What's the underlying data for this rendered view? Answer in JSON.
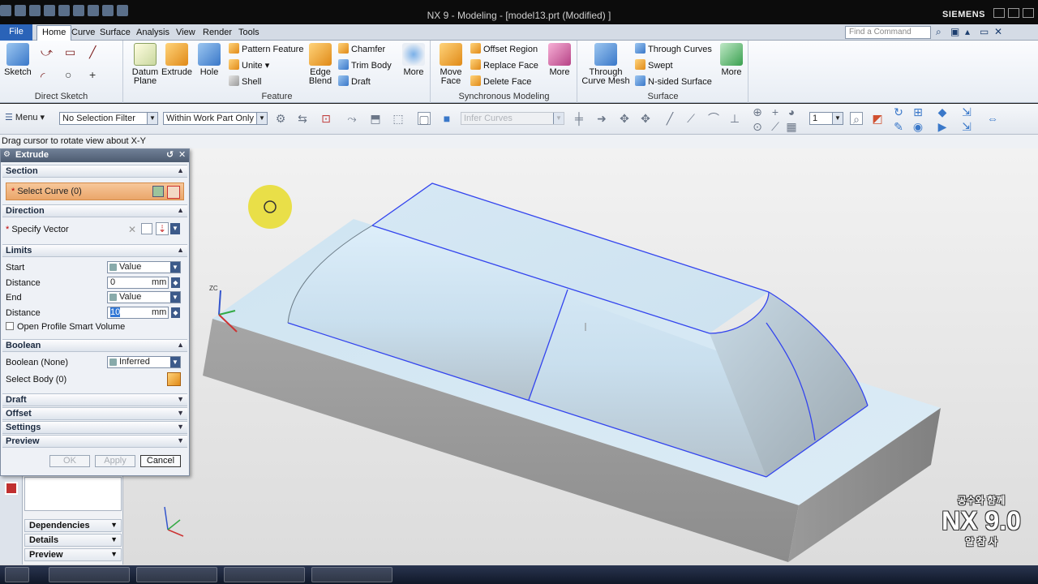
{
  "window": {
    "title": "NX 9 - Modeling - [model13.prt (Modified) ]",
    "brand": "SIEMENS",
    "qat_label": "Window"
  },
  "menu": {
    "items": [
      "File",
      "Home",
      "Curve",
      "Surface",
      "Analysis",
      "View",
      "Render",
      "Tools"
    ],
    "find_command_placeholder": "Find a Command"
  },
  "ribbon": {
    "direct_sketch": {
      "label": "Direct Sketch",
      "sketch": "Sketch"
    },
    "feature": {
      "label": "Feature",
      "datum_plane": "Datum Plane",
      "extrude": "Extrude",
      "hole": "Hole",
      "pattern_feature": "Pattern Feature",
      "unite": "Unite",
      "shell": "Shell",
      "edge_blend": "Edge Blend",
      "chamfer": "Chamfer",
      "trim_body": "Trim Body",
      "draft": "Draft",
      "more": "More"
    },
    "sync": {
      "label": "Synchronous Modeling",
      "move_face": "Move Face",
      "offset_region": "Offset Region",
      "replace_face": "Replace Face",
      "delete_face": "Delete Face",
      "more": "More"
    },
    "surface": {
      "label": "Surface",
      "through_curve_mesh": "Through Curve Mesh",
      "through_curves": "Through Curves",
      "swept": "Swept",
      "n_sided": "N-sided Surface",
      "more": "More"
    }
  },
  "selection_bar": {
    "menu": "Menu",
    "filter": "No Selection Filter",
    "scope": "Within Work Part Only",
    "curve_rule": "Infer Curves",
    "layer": "1"
  },
  "status_text": "Drag cursor to rotate view about X-Y",
  "dialog": {
    "title": "Extrude",
    "section": {
      "header": "Section",
      "select_curve": "Select Curve (0)"
    },
    "direction": {
      "header": "Direction",
      "specify_vector": "Specify Vector"
    },
    "limits": {
      "header": "Limits",
      "start_label": "Start",
      "start_value": "Value",
      "start_distance_label": "Distance",
      "start_distance": "0",
      "end_label": "End",
      "end_value": "Value",
      "end_distance_label": "Distance",
      "end_distance": "10",
      "unit": "mm",
      "open_profile": "Open Profile Smart Volume"
    },
    "boolean": {
      "header": "Boolean",
      "boolean_label": "Boolean (None)",
      "boolean_value": "Inferred",
      "select_body": "Select Body (0)"
    },
    "collapsed": [
      "Draft",
      "Offset",
      "Settings",
      "Preview"
    ],
    "buttons": {
      "ok": "OK",
      "apply": "Apply",
      "cancel": "Cancel"
    }
  },
  "resource_panel": {
    "rows": [
      "Dependencies",
      "Details",
      "Preview"
    ]
  },
  "viewport": {
    "triad_label": "ZC",
    "watermark_top": "공수와 함께",
    "watermark_main": "NX 9.0",
    "watermark_bottom": "알 참 사"
  },
  "colors": {
    "edge_highlight": "#3344ee",
    "menu_accent": "#2a63b8",
    "select_curve_bg": "#eaa66a",
    "cursor_halo": "#e8dc2a"
  }
}
